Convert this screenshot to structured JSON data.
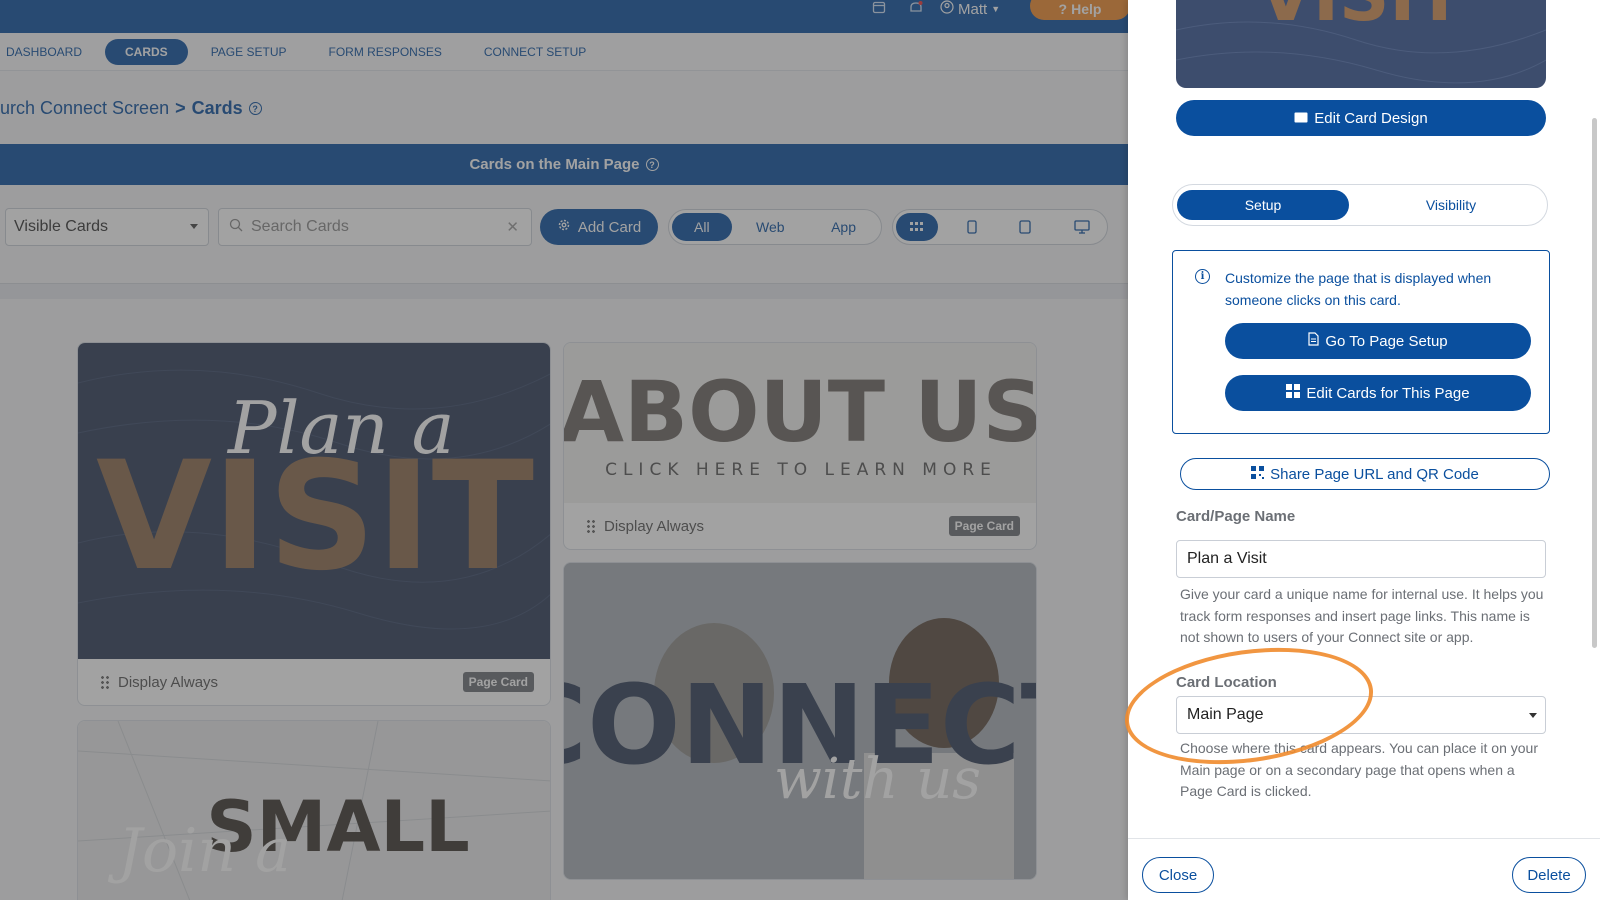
{
  "topbar": {
    "user_name": "Matt",
    "help_label": "Help"
  },
  "nav": {
    "tabs": [
      {
        "label": "DASHBOARD"
      },
      {
        "label": "CARDS"
      },
      {
        "label": "PAGE SETUP"
      },
      {
        "label": "FORM RESPONSES"
      },
      {
        "label": "CONNECT SETUP"
      }
    ],
    "active": "CARDS"
  },
  "breadcrumb": {
    "parent": "urch Connect Screen",
    "separator": ">",
    "current": "Cards"
  },
  "section": {
    "title": "Cards on the Main Page"
  },
  "toolbar": {
    "filter_value": "Visible Cards",
    "search_placeholder": "Search Cards",
    "add_card_label": "Add Card",
    "platform_options": [
      "All",
      "Web",
      "App"
    ],
    "platform_active": "All"
  },
  "cards": [
    {
      "artwork_text": [
        "Plan a",
        "VISIT"
      ],
      "display": "Display Always",
      "badge": "Page Card"
    },
    {
      "artwork_text": [
        "ABOUT US",
        "CLICK HERE TO LEARN MORE"
      ],
      "display": "Display Always",
      "badge": "Page Card"
    },
    {
      "artwork_text": [
        "Join a",
        "SMALL"
      ]
    },
    {
      "artwork_text": [
        "CONNECT",
        "with us"
      ]
    }
  ],
  "panel": {
    "preview_text": "VISIT",
    "edit_design_label": "Edit Card Design",
    "tabs": [
      "Setup",
      "Visibility"
    ],
    "tab_active": "Setup",
    "info_text": "Customize the page that is displayed when someone clicks on this card.",
    "go_to_page_setup_label": "Go To Page Setup",
    "edit_cards_label": "Edit Cards for This Page",
    "share_label": "Share Page URL and QR Code",
    "name_label": "Card/Page Name",
    "name_value": "Plan a Visit",
    "name_help": "Give your card a unique name for internal use. It helps you track form responses and insert page links. This name is not shown to users of your Connect site or app.",
    "location_label": "Card Location",
    "location_value": "Main Page",
    "location_help": "Choose where this card appears. You can place it on your Main page or on a secondary page that opens when a Page Card is clicked.",
    "close_label": "Close",
    "delete_label": "Delete"
  },
  "colors": {
    "brand_blue": "#0a4f9e",
    "accent_orange": "#f08b2c",
    "badge_gray": "#6b6f75"
  }
}
